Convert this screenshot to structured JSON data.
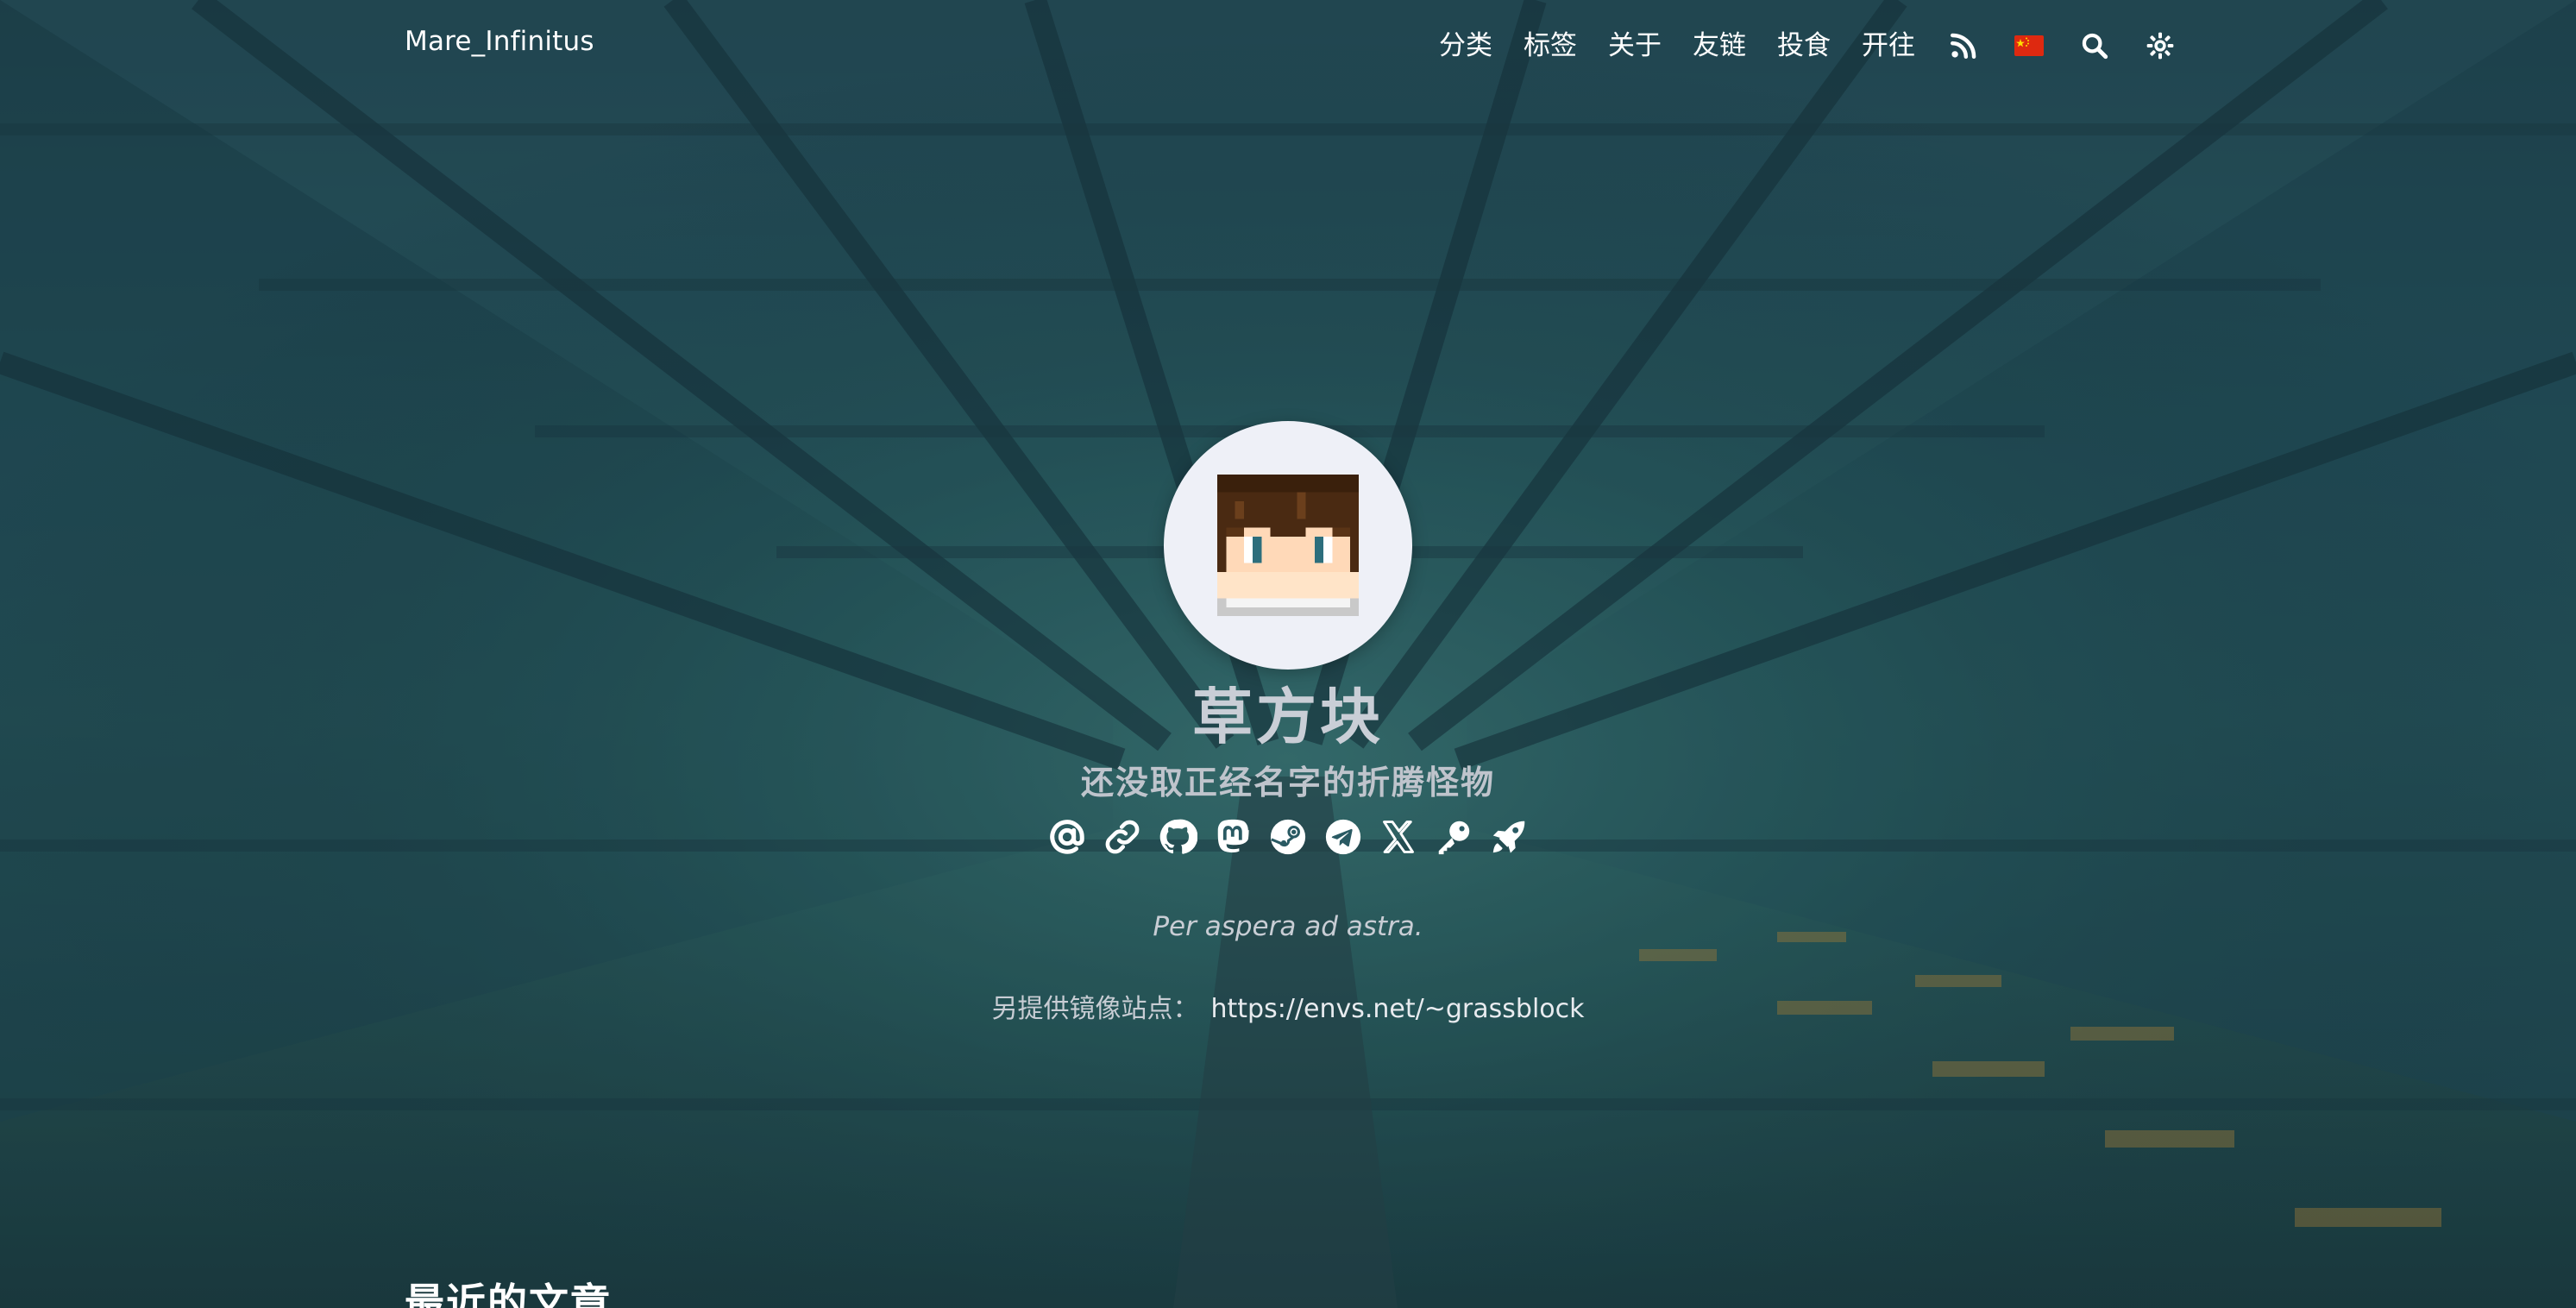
{
  "header": {
    "brand": "Mare_Infinitus",
    "menu": [
      {
        "label": "分类"
      },
      {
        "label": "标签"
      },
      {
        "label": "关于"
      },
      {
        "label": "友链"
      },
      {
        "label": "投食"
      },
      {
        "label": "开往"
      }
    ],
    "icons": [
      "rss-icon",
      "cn-flag-icon",
      "search-icon",
      "theme-toggle-icon"
    ]
  },
  "profile": {
    "name": "草方块",
    "subtitle": "还没取正经名字的折腾怪物",
    "socials": [
      "email-icon",
      "link-icon",
      "github-icon",
      "mastodon-icon",
      "steam-icon",
      "telegram-icon",
      "x-icon",
      "key-icon",
      "rocket-icon"
    ],
    "motto": "Per aspera ad astra.",
    "mirror_label": "另提供镜像站点：",
    "mirror_url": "https://envs.net/~grassblock"
  },
  "main": {
    "recent_title": "最近的文章"
  },
  "colors": {
    "text": "#ffffff",
    "muted_text": "#c8cdd4",
    "avatar_bg": "#eef0f7"
  }
}
